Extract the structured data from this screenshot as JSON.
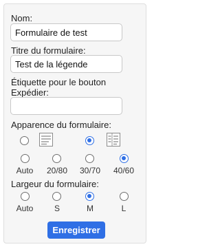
{
  "form": {
    "name_label": "Nom:",
    "name_value": "Formulaire de test",
    "title_label": "Titre du formulaire:",
    "title_value": "Test de la légende",
    "submit_label_line1": "Étiquette pour le bouton",
    "submit_label_line2": "Expédier:",
    "submit_value": ""
  },
  "appearance": {
    "label": "Apparence du formulaire:",
    "options": [
      {
        "label": "Auto",
        "checked": false,
        "icon": "none"
      },
      {
        "label": "20/80",
        "checked": false,
        "icon": "layout-20-80-icon"
      },
      {
        "label": "30/70",
        "checked": true,
        "icon": "none"
      },
      {
        "label": "40/60",
        "checked": false,
        "icon": "layout-40-60-icon"
      }
    ],
    "lower_row_checked_index": 3
  },
  "width": {
    "label": "Largeur du formulaire:",
    "options": [
      {
        "label": "Auto",
        "checked": false
      },
      {
        "label": "S",
        "checked": false
      },
      {
        "label": "M",
        "checked": true
      },
      {
        "label": "L",
        "checked": false
      }
    ]
  },
  "save_button": "Enregistrer",
  "colors": {
    "accent": "#2f6fe5",
    "panel_bg": "#f6f6f6",
    "border": "#dedede"
  }
}
